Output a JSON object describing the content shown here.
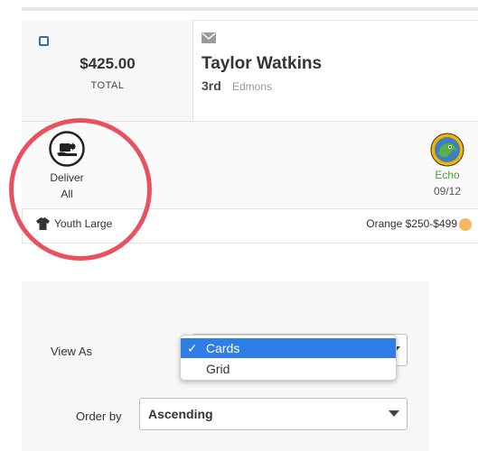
{
  "order_card": {
    "total_amount": "$425.00",
    "total_label": "TOTAL",
    "customer_name": "Taylor Watkins",
    "grade": "3rd",
    "school": "Edmons",
    "action": {
      "line1": "Deliver",
      "line2": "All",
      "icon": "deliver-icon"
    },
    "seller": {
      "name": "Echo",
      "date": "09/12",
      "avatar": "echo-avatar"
    },
    "shirt_size": "Youth Large",
    "price_tier": "Orange $250-$499",
    "colors": {
      "checkbox": "#2e6fb8",
      "seller_name": "#4b9a3f",
      "tier_dot": "#f4b860",
      "highlight_ring": "#e8525e"
    }
  },
  "settings": {
    "view_as": {
      "label": "View As",
      "options": [
        "Cards",
        "Grid"
      ],
      "selected": "Cards",
      "check_mark": "✓"
    },
    "order_by": {
      "label": "Order by",
      "value": "Ascending"
    },
    "colors": {
      "selected_option": "#2f7ee8"
    }
  }
}
